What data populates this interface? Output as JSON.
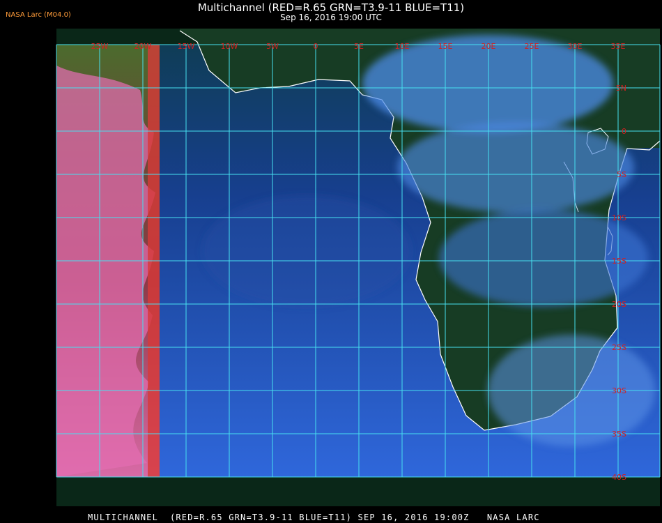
{
  "organization": "NASA Larc (M04.0)",
  "title": "Multichannel (RED=R.65 GRN=T3.9-11 BLUE=T11)",
  "timestamp": "Sep 16, 2016 19:00 UTC",
  "bottom_caption": "MULTICHANNEL  (RED=R.65 GRN=T3.9-11 BLUE=T11) SEP 16, 2016 19:00Z   NASA LARC",
  "map": {
    "longitude_labels": [
      "25W",
      "20W",
      "15W",
      "10W",
      "5W",
      "0",
      "5E",
      "10E",
      "15E",
      "20E",
      "25E",
      "30E",
      "35E"
    ],
    "latitude_labels": [
      "5N",
      "0",
      "5S",
      "10S",
      "15S",
      "20S",
      "25S",
      "30S",
      "35S",
      "40S"
    ],
    "colors": {
      "grid": "#47e0f0",
      "tick_label": "#d42020",
      "coastline": "#ffffff",
      "ocean": "#1f52b5",
      "land": "#12361f",
      "cloud": "#4b8fe8",
      "sunlit_cloud": "#e36db1"
    }
  }
}
